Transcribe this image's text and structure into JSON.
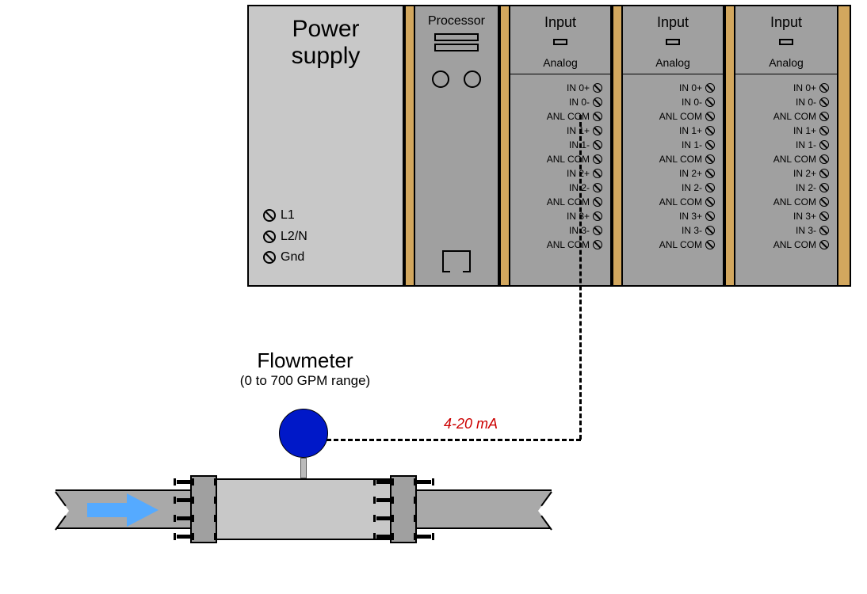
{
  "plc": {
    "power_supply": {
      "title_l1": "Power",
      "title_l2": "supply",
      "terminals": [
        "L1",
        "L2/N",
        "Gnd"
      ]
    },
    "processor": {
      "title": "Processor"
    },
    "input_module": {
      "title": "Input",
      "subtitle": "Analog",
      "terminals": [
        "IN 0+",
        "IN 0-",
        "ANL COM",
        "IN 1+",
        "IN 1-",
        "ANL COM",
        "IN 2+",
        "IN 2-",
        "ANL COM",
        "IN 3+",
        "IN 3-",
        "ANL COM"
      ]
    },
    "module_count": 3
  },
  "flowmeter": {
    "title": "Flowmeter",
    "range": "(0 to 700 GPM range)",
    "range_min_gpm": 0,
    "range_max_gpm": 700
  },
  "signal": {
    "label": "4-20 mA",
    "low_ma": 4,
    "high_ma": 20,
    "connected_to": "Input module 1, IN 0-"
  }
}
